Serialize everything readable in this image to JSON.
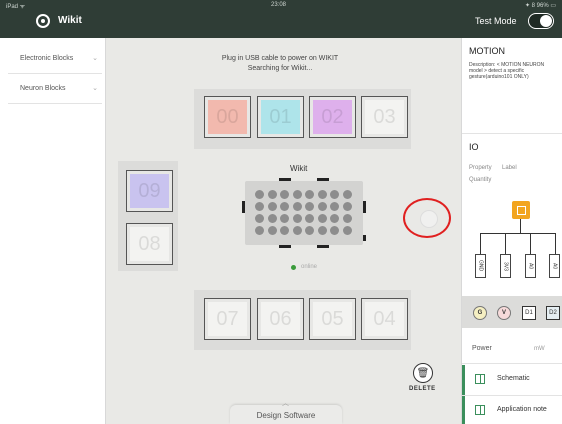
{
  "statusbar": {
    "left": "iPad ᯤ",
    "time": "23:08",
    "right": "✦ 8 96% ▭"
  },
  "header": {
    "app_title": "Wikit",
    "test_mode_label": "Test Mode",
    "test_mode_on": true
  },
  "sidebar": {
    "items": [
      {
        "label": "Electronic Blocks"
      },
      {
        "label": "Neuron Blocks"
      }
    ]
  },
  "center": {
    "message_line1": "Plug in USB cable to power on WIKIT",
    "message_line2": "Searching for Wikit...",
    "top_blocks": [
      {
        "label": "00",
        "color": "#f2b9ae"
      },
      {
        "label": "01",
        "color": "#aee4ea"
      },
      {
        "label": "02",
        "color": "#deb0ec"
      },
      {
        "label": "03",
        "color": "#f3f3f1"
      }
    ],
    "left_blocks": [
      {
        "label": "09",
        "color": "#c9c3ef"
      },
      {
        "label": "08",
        "color": "#f3f3f1"
      }
    ],
    "bottom_blocks": [
      {
        "label": "07",
        "color": "#f3f3f1"
      },
      {
        "label": "06",
        "color": "#f3f3f1"
      },
      {
        "label": "05",
        "color": "#f3f3f1"
      },
      {
        "label": "04",
        "color": "#f3f3f1"
      }
    ],
    "board_label": "Wikit",
    "board_status": "online",
    "delete_label": "DELETE",
    "design_tab_label": "Design Software"
  },
  "right_panel": {
    "title": "MOTION",
    "description": "Description: < MOTION NEURON model > detect a specific gesture(arduino101 ONLY)",
    "io_label": "IO",
    "property_label": "Property",
    "label_label": "Label",
    "quantity_label": "Quantity",
    "pin_labels": [
      "GND",
      "3V3",
      "A0",
      "A0"
    ],
    "pin_circles": [
      "G",
      "V"
    ],
    "pin_squares": [
      "D1",
      "D2"
    ],
    "power_label": "Power",
    "power_unit": "mW",
    "links": [
      {
        "label": "Schematic"
      },
      {
        "label": "Application note"
      }
    ],
    "colors": {
      "accent": "#3b8f5c",
      "module": "#f2a51f"
    }
  }
}
